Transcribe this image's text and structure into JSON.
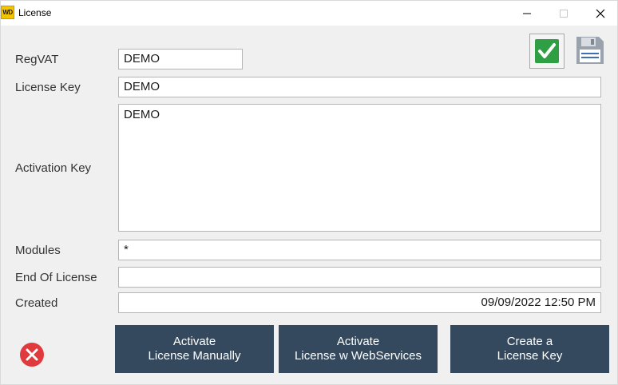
{
  "window": {
    "title": "License",
    "app_icon_text": "WD"
  },
  "form": {
    "regvat": {
      "label": "RegVAT",
      "value": "DEMO"
    },
    "license_key": {
      "label": "License Key",
      "value": "DEMO"
    },
    "activation_key": {
      "label": "Activation Key",
      "value": "DEMO"
    },
    "modules": {
      "label": "Modules",
      "value": "*"
    },
    "end_of_license": {
      "label": "End Of License",
      "value": ""
    },
    "created": {
      "label": "Created",
      "value": "09/09/2022 12:50 PM"
    }
  },
  "toolbar": {
    "confirm_icon": "green-checkmark-icon",
    "save_icon": "floppy-disk-icon"
  },
  "actions": {
    "activate_manually": {
      "line1": "Activate",
      "line2": "License Manually"
    },
    "activate_webservices": {
      "line1": "Activate",
      "line2": "License w WebServices"
    },
    "create_key": {
      "line1": "Create a",
      "line2": "License Key"
    }
  },
  "colors": {
    "button_bg": "#34495e",
    "cancel_red": "#e0393e",
    "check_green": "#2ea043",
    "floppy_blue": "#3d6fb6"
  }
}
